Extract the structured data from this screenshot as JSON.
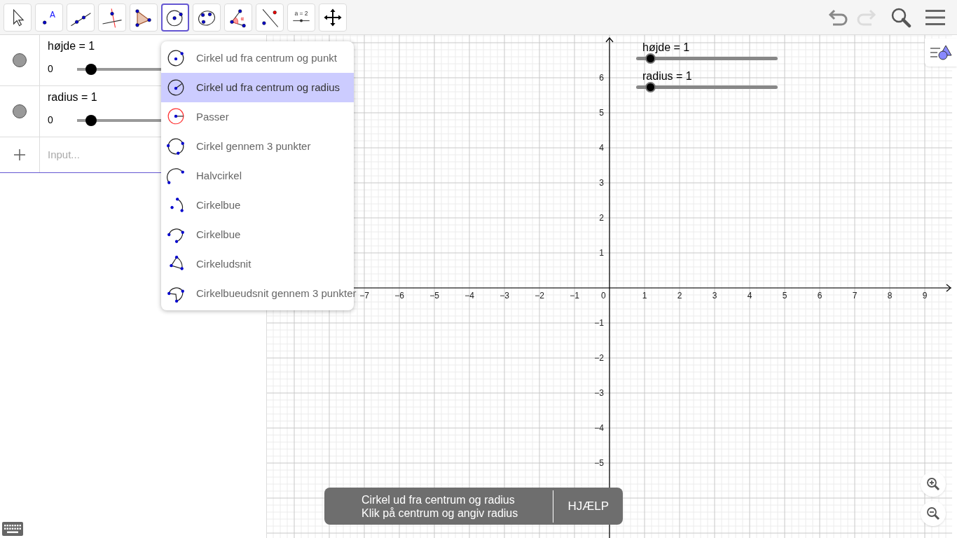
{
  "toolbar": {
    "tools": [
      {
        "kind": "move",
        "selected": false
      },
      {
        "kind": "point",
        "text": "A",
        "selected": false
      },
      {
        "kind": "line",
        "selected": false
      },
      {
        "kind": "perpendicular",
        "selected": false
      },
      {
        "kind": "polygon",
        "selected": false
      },
      {
        "kind": "circle",
        "selected": true
      },
      {
        "kind": "conic",
        "selected": false
      },
      {
        "kind": "angle",
        "text": "α",
        "selected": false
      },
      {
        "kind": "reflect",
        "selected": false
      },
      {
        "kind": "slider",
        "text": "a = 2",
        "selected": false
      },
      {
        "kind": "move-view",
        "selected": false
      }
    ],
    "undo": {
      "disabled": false
    },
    "redo": {
      "disabled": true
    }
  },
  "algebra": {
    "items": [
      {
        "label": "højde = 1",
        "min": "0",
        "level": 0.1
      },
      {
        "label": "radius = 1",
        "min": "0",
        "level": 0.1
      }
    ],
    "input": {
      "placeholder": "Input..."
    }
  },
  "tool_menu": {
    "items": [
      {
        "kind": "center-point",
        "label": "Cirkel ud fra centrum og punkt",
        "selected": false
      },
      {
        "kind": "center-radius",
        "label": "Cirkel ud fra centrum og radius",
        "selected": true
      },
      {
        "kind": "compass",
        "label": "Passer",
        "selected": false
      },
      {
        "kind": "three-points",
        "label": "Cirkel gennem 3 punkter",
        "selected": false
      },
      {
        "kind": "semicircle",
        "label": "Halvcirkel",
        "selected": false
      },
      {
        "kind": "arc",
        "label": "Cirkelbue",
        "selected": false
      },
      {
        "kind": "circum-arc",
        "label": "Cirkelbue",
        "selected": false
      },
      {
        "kind": "sector",
        "label": "Cirkeludsnit",
        "selected": false
      },
      {
        "kind": "circum-sector",
        "label": "Cirkelbueudsnit gennem 3 punkter",
        "selected": false
      }
    ]
  },
  "graphics": {
    "origin_label": "0",
    "x_labels": [
      "−7",
      "−6",
      "−5",
      "−4",
      "−3",
      "−2",
      "−1",
      "1",
      "2",
      "3",
      "4",
      "5",
      "6",
      "7",
      "8",
      "9"
    ],
    "y_labels": [
      "6",
      "5",
      "4",
      "3",
      "2",
      "1",
      "−1",
      "−2",
      "−3",
      "−4",
      "−5"
    ],
    "sliders": [
      {
        "label": "højde = 1",
        "level": 0.1
      },
      {
        "label": "radius = 1",
        "level": 0.1
      }
    ]
  },
  "toast": {
    "title": "Cirkel ud fra centrum og radius",
    "hint": "Klik på centrum og angiv radius",
    "help": "HJÆLP"
  }
}
